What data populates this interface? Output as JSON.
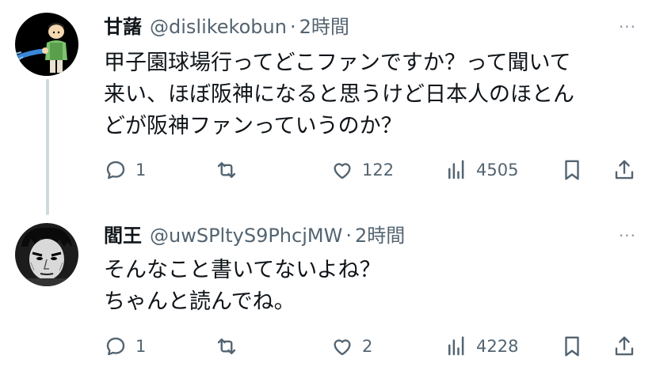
{
  "tweets": [
    {
      "name": "甘藷",
      "handle": "@dislikekobun",
      "separator": "·",
      "time": "2時間",
      "text_lines": [
        "甲子園球場行ってどこファンですか？って聞いて",
        "来い、ほぼ阪神になると思うけど日本人のほとん",
        "どが阪神ファンっていうのか？"
      ],
      "stats": {
        "replies": "1",
        "likes": "122",
        "views": "4505"
      }
    },
    {
      "name": "閻王",
      "handle": "@uwSPltyS9PhcjMW",
      "separator": "·",
      "time": "2時間",
      "text_lines": [
        "そんなこと書いてないよね？",
        "ちゃんと読んでね。"
      ],
      "stats": {
        "replies": "1",
        "likes": "2",
        "views": "4228"
      }
    }
  ],
  "more_label": "···",
  "colors": {
    "text": "#0f1419",
    "muted": "#536471",
    "thread_line": "#cfd9de"
  }
}
